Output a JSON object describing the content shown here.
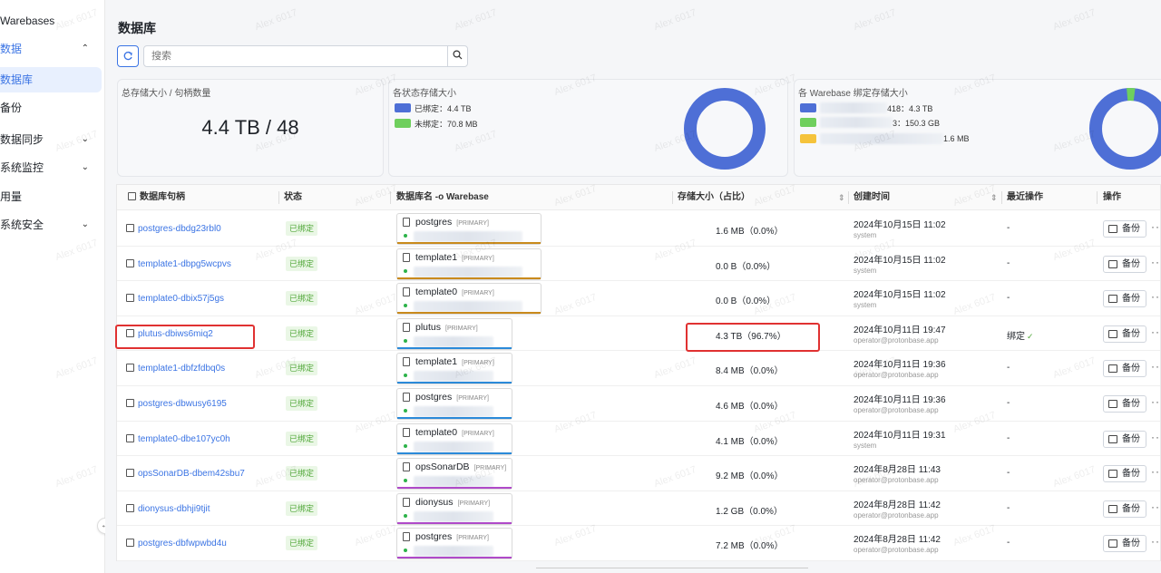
{
  "sidebar": {
    "brand": "Warebases",
    "items": [
      {
        "label": "数据",
        "chevron": "⌃"
      },
      {
        "label": "数据库"
      },
      {
        "label": "备份"
      },
      {
        "label": "数据同步",
        "chevron": "⌄"
      },
      {
        "label": "系统监控",
        "chevron": "⌄"
      },
      {
        "label": "用量"
      },
      {
        "label": "系统安全",
        "chevron": "⌄"
      }
    ],
    "collapse_icon": "←"
  },
  "header": {
    "title": "数据库"
  },
  "search": {
    "placeholder": "搜索"
  },
  "cards": {
    "total": {
      "title": "总存储大小 / 句柄数量",
      "value": "4.4 TB / 48"
    },
    "status": {
      "title": "各状态存储大小",
      "legend": [
        {
          "label": "已绑定：4.4 TB",
          "color": "#4e6fd6"
        },
        {
          "label": "未绑定：70.8 MB",
          "color": "#6fcf5d"
        }
      ]
    },
    "warebase": {
      "title": "各 Warebase 绑定存储大小",
      "legend": [
        {
          "label": "418：4.3 TB",
          "color": "#4e6fd6"
        },
        {
          "label": "3：150.3 GB",
          "color": "#6fcf5d"
        },
        {
          "label": "1.6 MB",
          "color": "#f5c33b"
        }
      ]
    }
  },
  "table": {
    "headers": {
      "handle": "数据库句柄",
      "status": "状态",
      "dbname": "数据库名 -o Warebase",
      "size": "存储大小（占比）",
      "created": "创建时间",
      "recent": "最近操作",
      "actions": "操作"
    },
    "rows": [
      {
        "handle": "postgres-dbdg23rbl0",
        "status": "已绑定",
        "db": "postgres",
        "tag": "[PRIMARY]",
        "size": "1.6 MB（0.0%）",
        "date": "2024年10月15日 11:02",
        "creator": "system",
        "recent": "-",
        "bar": "#c98a1c"
      },
      {
        "handle": "template1-dbpg5wcpvs",
        "status": "已绑定",
        "db": "template1",
        "tag": "[PRIMARY]",
        "size": "0.0 B（0.0%）",
        "date": "2024年10月15日 11:02",
        "creator": "system",
        "recent": "-",
        "bar": "#c98a1c"
      },
      {
        "handle": "template0-dbix57j5gs",
        "status": "已绑定",
        "db": "template0",
        "tag": "[PRIMARY]",
        "size": "0.0 B（0.0%）",
        "date": "2024年10月15日 11:02",
        "creator": "system",
        "recent": "-",
        "bar": "#c98a1c"
      },
      {
        "handle": "plutus-dbiws6miq2",
        "status": "已绑定",
        "db": "plutus",
        "tag": "[PRIMARY]",
        "size": "4.3 TB（96.7%）",
        "date": "2024年10月11日 19:47",
        "creator": "operator@protonbase.app",
        "recent": "绑定",
        "bar": "#2b8ad9"
      },
      {
        "handle": "template1-dbfzfdbq0s",
        "status": "已绑定",
        "db": "template1",
        "tag": "[PRIMARY]",
        "size": "8.4 MB（0.0%）",
        "date": "2024年10月11日 19:36",
        "creator": "operator@protonbase.app",
        "recent": "-",
        "bar": "#2b8ad9"
      },
      {
        "handle": "postgres-dbwusy6195",
        "status": "已绑定",
        "db": "postgres",
        "tag": "[PRIMARY]",
        "size": "4.6 MB（0.0%）",
        "date": "2024年10月11日 19:36",
        "creator": "operator@protonbase.app",
        "recent": "-",
        "bar": "#2b8ad9"
      },
      {
        "handle": "template0-dbe107yc0h",
        "status": "已绑定",
        "db": "template0",
        "tag": "[PRIMARY]",
        "size": "4.1 MB（0.0%）",
        "date": "2024年10月11日 19:31",
        "creator": "system",
        "recent": "-",
        "bar": "#2b8ad9"
      },
      {
        "handle": "opsSonarDB-dbem42sbu7",
        "status": "已绑定",
        "db": "opsSonarDB",
        "tag": "[PRIMARY]",
        "size": "9.2 MB（0.0%）",
        "date": "2024年8月28日 11:43",
        "creator": "operator@protonbase.app",
        "recent": "-",
        "bar": "#b04ac9"
      },
      {
        "handle": "dionysus-dbhji9tjit",
        "status": "已绑定",
        "db": "dionysus",
        "tag": "[PRIMARY]",
        "size": "1.2 GB（0.0%）",
        "date": "2024年8月28日 11:42",
        "creator": "operator@protonbase.app",
        "recent": "-",
        "bar": "#b04ac9"
      },
      {
        "handle": "postgres-dbfwpwbd4u",
        "status": "已绑定",
        "db": "postgres",
        "tag": "[PRIMARY]",
        "size": "7.2 MB（0.0%）",
        "date": "2024年8月28日 11:42",
        "creator": "operator@protonbase.app",
        "recent": "-",
        "bar": "#b04ac9"
      }
    ],
    "backup_label": "备份",
    "more_label": "···"
  },
  "watermark": "Alex 6017",
  "colors": {
    "accent": "#3b74e4",
    "highlight": "#e03131",
    "success": "#52a83a"
  }
}
